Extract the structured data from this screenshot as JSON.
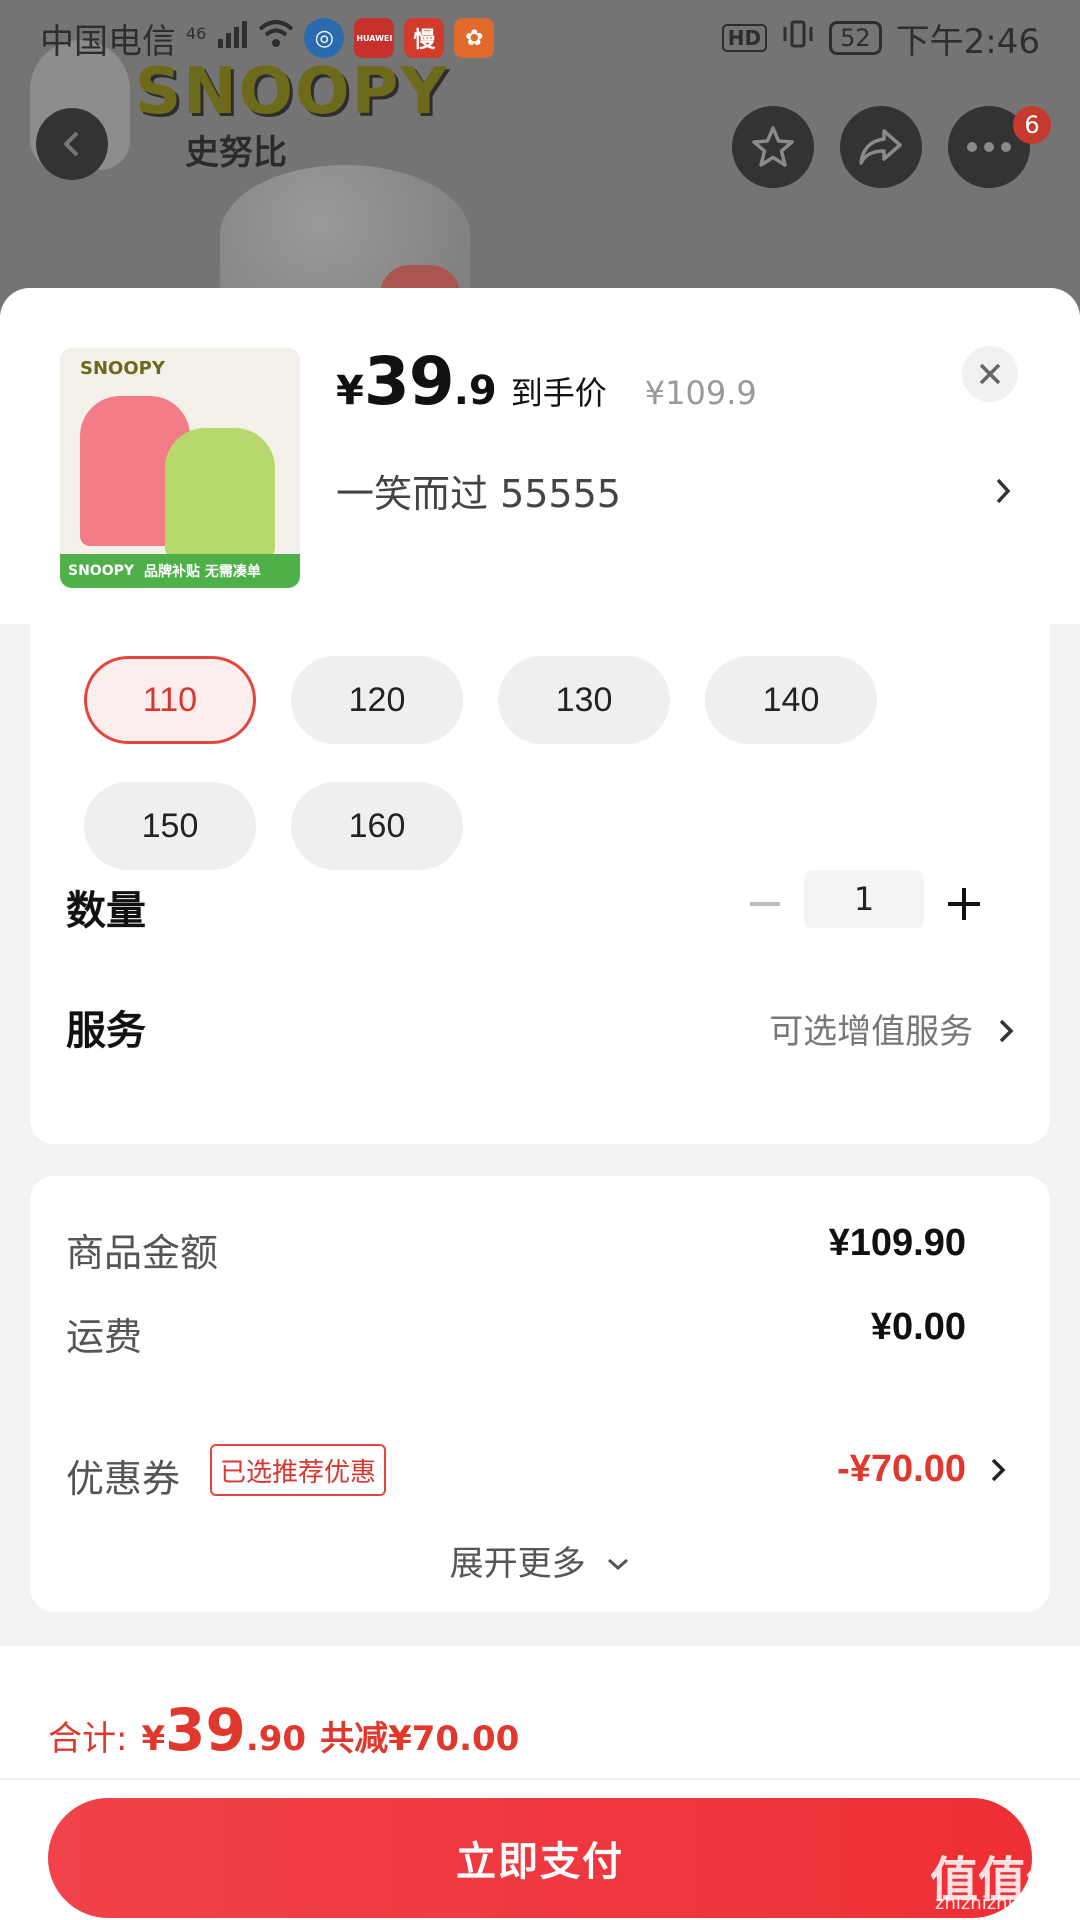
{
  "status_bar": {
    "carrier": "中国电信",
    "network": "46",
    "app_icons": [
      "browser-icon",
      "huawei-icon",
      "slow-icon",
      "app-icon"
    ],
    "slow_label": "慢",
    "huawei_label": "HUAWEI",
    "hd": "HD",
    "battery": "52",
    "time": "下午2:46"
  },
  "background": {
    "brand": "SNOOPY",
    "brand_cn": "史努比",
    "more_badge": "6"
  },
  "product": {
    "thumb_brand": "SNOOPY",
    "thumb_banner_brand": "SNOOPY",
    "thumb_banner_text": "品牌补贴 无需凑单",
    "price_yen": "¥",
    "price_int": "39",
    "price_dec": ".9",
    "price_label": "到手价",
    "original_price": "¥109.9",
    "selected_spec": "一笑而过  55555"
  },
  "sizes": {
    "options": [
      "110",
      "120",
      "130",
      "140",
      "150",
      "160"
    ],
    "selected": "110"
  },
  "quantity": {
    "label": "数量",
    "value": "1"
  },
  "service": {
    "label": "服务",
    "link": "可选增值服务"
  },
  "summary": {
    "goods_label": "商品金额",
    "goods_value": "¥109.90",
    "shipping_label": "运费",
    "shipping_value": "¥0.00",
    "coupon_label": "优惠券",
    "coupon_tag": "已选推荐优惠",
    "coupon_value": "-¥70.00",
    "expand": "展开更多"
  },
  "footer": {
    "total_label": "合计:",
    "total_yen": "¥",
    "total_int": "39",
    "total_dec": ".90",
    "total_saving": "共减¥70.00",
    "pay_button": "立即支付"
  },
  "watermark": {
    "text": "值值值",
    "sub": "zhizhizhi.com"
  },
  "colors": {
    "accent": "#e5453d",
    "pay_button": "#ee2f35"
  }
}
